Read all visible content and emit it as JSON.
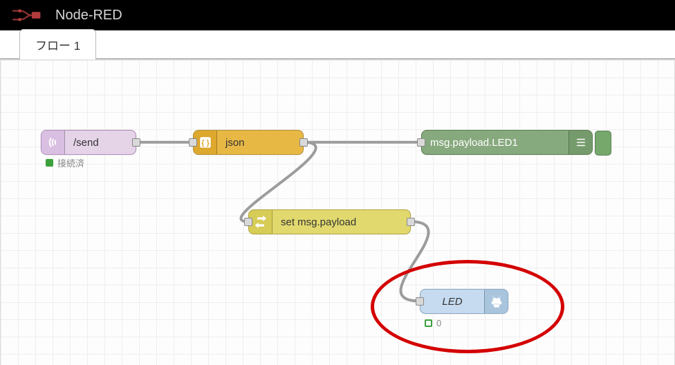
{
  "header": {
    "title": "Node-RED"
  },
  "tabs": [
    {
      "label": "フロー 1"
    }
  ],
  "nodes": {
    "wsin": {
      "label": "/send",
      "status_text": "接続済"
    },
    "json": {
      "label": "json"
    },
    "debug": {
      "label": "msg.payload.LED1"
    },
    "change": {
      "label": "set msg.payload"
    },
    "gpio": {
      "label": "LED",
      "status_text": "0"
    }
  },
  "colors": {
    "wire": "#9c9c9c",
    "highlight": "#d40000"
  }
}
